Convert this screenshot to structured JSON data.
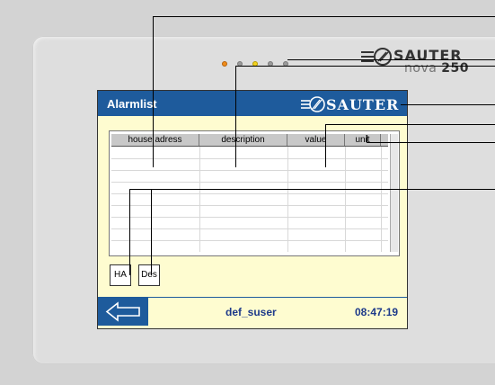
{
  "device": {
    "brand": "SAUTER",
    "model_prefix": "nova",
    "model_number": "250",
    "leds": [
      {
        "name": "led-1",
        "color": "#f08c1a"
      },
      {
        "name": "led-2",
        "color": "#9a9a9a"
      },
      {
        "name": "led-3",
        "color": "#f2d21e"
      },
      {
        "name": "led-4",
        "color": "#9a9a9a"
      },
      {
        "name": "led-5",
        "color": "#9a9a9a"
      }
    ]
  },
  "screen": {
    "title": "Alarmlist",
    "logo_text": "SAUTER",
    "columns": [
      "house adress",
      "description",
      "value",
      "unit"
    ],
    "buttons": {
      "ha": "HA",
      "des": "Des"
    },
    "status": {
      "user": "def_suser",
      "time": "08:47:19"
    },
    "colors": {
      "accent": "#1e5b9c",
      "background": "#fefcd0"
    }
  }
}
